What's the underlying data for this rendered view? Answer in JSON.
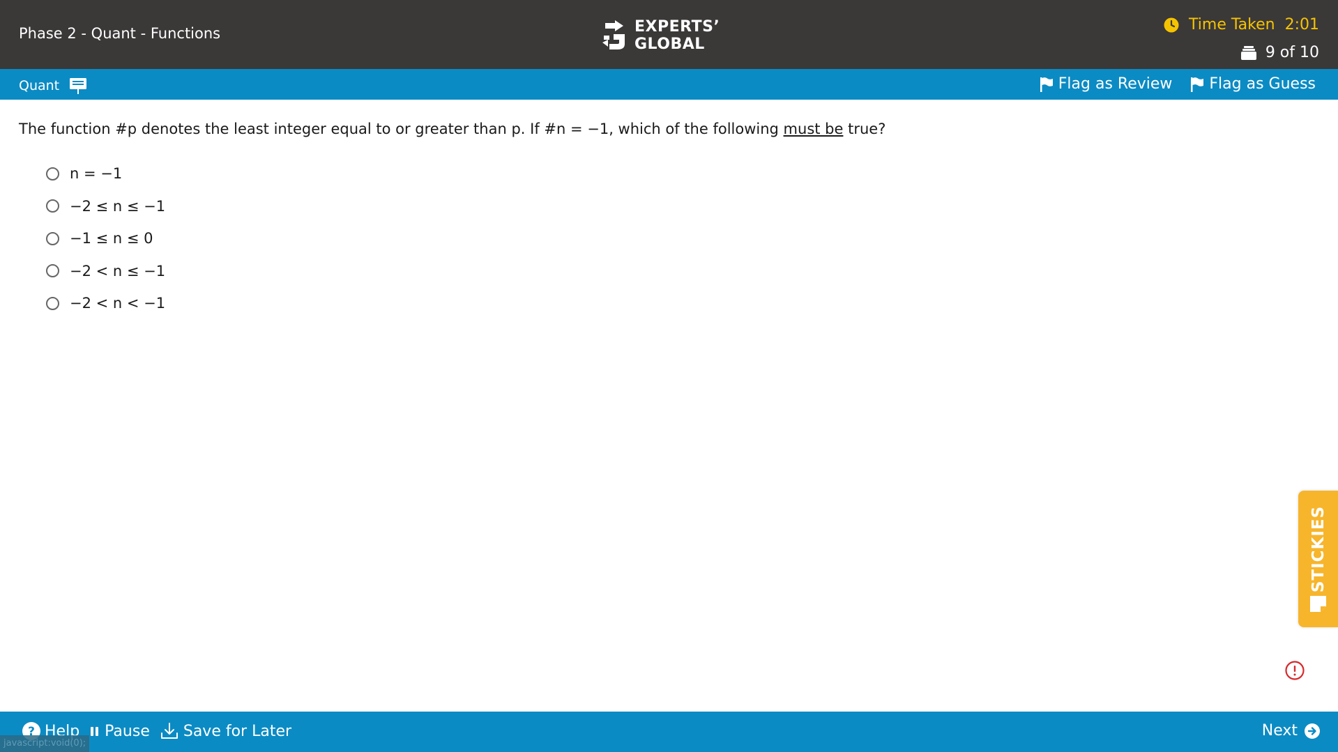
{
  "header": {
    "test_title": "Phase 2 - Quant - Functions",
    "logo_line1": "EXPERTS’",
    "logo_line2": "GLOBAL",
    "timer_label": "Time Taken",
    "timer_value": "2:01",
    "progress": "9 of 10"
  },
  "section_bar": {
    "section_name": "Quant",
    "flag_review_label": "Flag as Review",
    "flag_guess_label": "Flag as Guess"
  },
  "question": {
    "text_before": "The function #p denotes the least integer equal to or greater than p. If #n = −1, which of the following ",
    "emphasis": "must be",
    "text_after": " true?",
    "options": [
      "n = −1",
      "−2 ≤ n ≤ −1",
      "−1 ≤ n ≤ 0",
      "−2 < n ≤ −1",
      "−2 < n < −1"
    ]
  },
  "stickies": {
    "label": "STICKIES"
  },
  "footer": {
    "help_label": "Help",
    "pause_label": "Pause",
    "save_label": "Save for Later",
    "next_label": "Next"
  },
  "status": {
    "text": "javascript:void(0);"
  },
  "colors": {
    "header_bg": "#3b3838",
    "accent_blue": "#0b8bc4",
    "timer_yellow": "#f5c400",
    "stickies_orange": "#f7b52c",
    "alert_red": "#d6292b"
  }
}
